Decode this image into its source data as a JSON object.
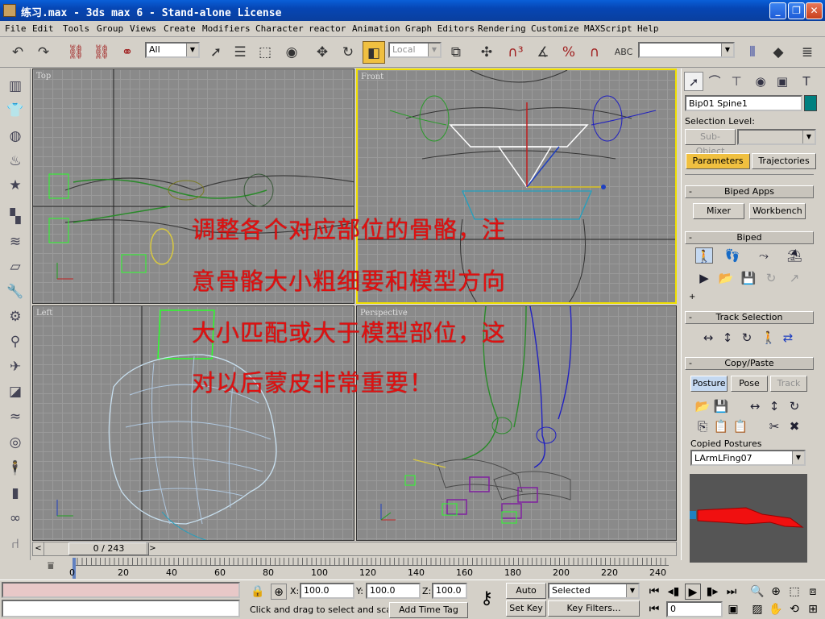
{
  "window": {
    "title": "练习.max - 3ds max 6 - Stand-alone License"
  },
  "menu": [
    "File",
    "Edit",
    "Tools",
    "Group",
    "Views",
    "Create",
    "Modifiers",
    "Character",
    "reactor",
    "Animation",
    "Graph Editors",
    "Rendering",
    "Customize",
    "MAXScript",
    "Help"
  ],
  "toolbar": {
    "filter_value": "All",
    "coord_value": "Local",
    "named_sel_placeholder": ""
  },
  "viewports": {
    "top": "Top",
    "front": "Front",
    "left": "Left",
    "perspective": "Perspective"
  },
  "annotation": {
    "line1": "调整各个对应部位的骨骼，注",
    "line2": "意骨骼大小粗细要和模型方向",
    "line3": "大小匹配或大于模型部位，这",
    "line4": "对以后蒙皮非常重要！"
  },
  "panel": {
    "object_name": "Bip01 Spine1",
    "object_color": "#008080",
    "selection_level_label": "Selection Level:",
    "sub_object": "Sub-Object",
    "parameters_tab": "Parameters",
    "trajectories_tab": "Trajectories",
    "biped_apps_title": "Biped Apps",
    "mixer": "Mixer",
    "workbench": "Workbench",
    "biped_title": "Biped",
    "track_selection_title": "Track Selection",
    "copy_paste_title": "Copy/Paste",
    "posture": "Posture",
    "pose": "Pose",
    "track": "Track",
    "copied_postures_label": "Copied Postures",
    "copied_posture_value": "LArmLFing07"
  },
  "timeline": {
    "slider_label": "0 / 243",
    "ticks": [
      "0",
      "20",
      "40",
      "60",
      "80",
      "100",
      "120",
      "140",
      "160",
      "180",
      "200",
      "220",
      "240"
    ]
  },
  "status": {
    "x_label": "X:",
    "x_value": "100.0",
    "y_label": "Y:",
    "y_value": "100.0",
    "z_label": "Z:",
    "z_value": "100.0",
    "prompt": "Click and drag to select and scale o",
    "add_time_tag": "Add Time Tag",
    "auto_key": "Auto Key",
    "set_key": "Set Key",
    "key_mode_value": "Selected",
    "key_filters": "Key Filters...",
    "frame_value": "0"
  },
  "colors": {
    "accent_yellow": "#f0e000",
    "annotation_red": "#e01010",
    "active_orange": "#f0c040"
  }
}
